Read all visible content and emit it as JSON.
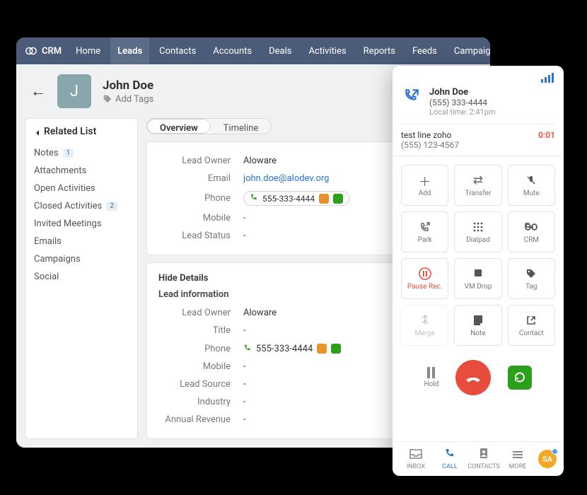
{
  "crm": {
    "brand": "CRM",
    "nav": {
      "home": "Home",
      "leads": "Leads",
      "contacts": "Contacts",
      "accounts": "Accounts",
      "deals": "Deals",
      "activities": "Activities",
      "reports": "Reports",
      "feeds": "Feeds",
      "campaigns": "Campaigns"
    },
    "lead": {
      "initial": "J",
      "name": "John Doe",
      "add_tags": "Add Tags"
    },
    "sidebar": {
      "title": "Related List",
      "items": {
        "notes": "Notes",
        "notes_count": "1",
        "attachments": "Attachments",
        "open_activities": "Open Activities",
        "closed_activities": "Closed Activities",
        "closed_count": "2",
        "invited": "Invited Meetings",
        "emails": "Emails",
        "campaigns": "Campaigns",
        "social": "Social"
      }
    },
    "tabs": {
      "overview": "Overview",
      "timeline": "Timeline"
    },
    "summary": {
      "lead_owner_label": "Lead Owner",
      "lead_owner_value": "Aloware",
      "email_label": "Email",
      "email_value": "john.doe@alodev.org",
      "phone_label": "Phone",
      "phone_value": "555-333-4444",
      "mobile_label": "Mobile",
      "mobile_value": "-",
      "status_label": "Lead Status",
      "status_value": "-"
    },
    "details": {
      "hide": "Hide Details",
      "section": "Lead information",
      "lead_owner_label": "Lead Owner",
      "lead_owner_value": "Aloware",
      "title_label": "Title",
      "title_value": "-",
      "phone_label": "Phone",
      "phone_value": "555-333-4444",
      "mobile_label": "Mobile",
      "mobile_value": "-",
      "source_label": "Lead Source",
      "source_value": "-",
      "industry_label": "Industry",
      "industry_value": "-",
      "revenue_label": "Annual Revenue",
      "revenue_value": "-"
    }
  },
  "dialer": {
    "caller": {
      "name": "John Doe",
      "phone": "(555) 333-4444",
      "local": "Local time: 2:41pm"
    },
    "line": {
      "name": "test line zoho",
      "phone": "(555) 123-4567",
      "timer": "0:01"
    },
    "buttons": {
      "add": "Add",
      "transfer": "Transfer",
      "mute": "Mute",
      "park": "Park",
      "dialpad": "Dialpad",
      "crm": "CRM",
      "pause": "Pause Rec.",
      "vmdrop": "VM Drop",
      "tag": "Tag",
      "merge": "Merge",
      "note": "Note",
      "contact": "Contact"
    },
    "hold": "Hold",
    "footer": {
      "inbox": "INBOX",
      "call": "CALL",
      "contacts": "CONTACTS",
      "more": "MORE",
      "agent": "SA"
    }
  }
}
